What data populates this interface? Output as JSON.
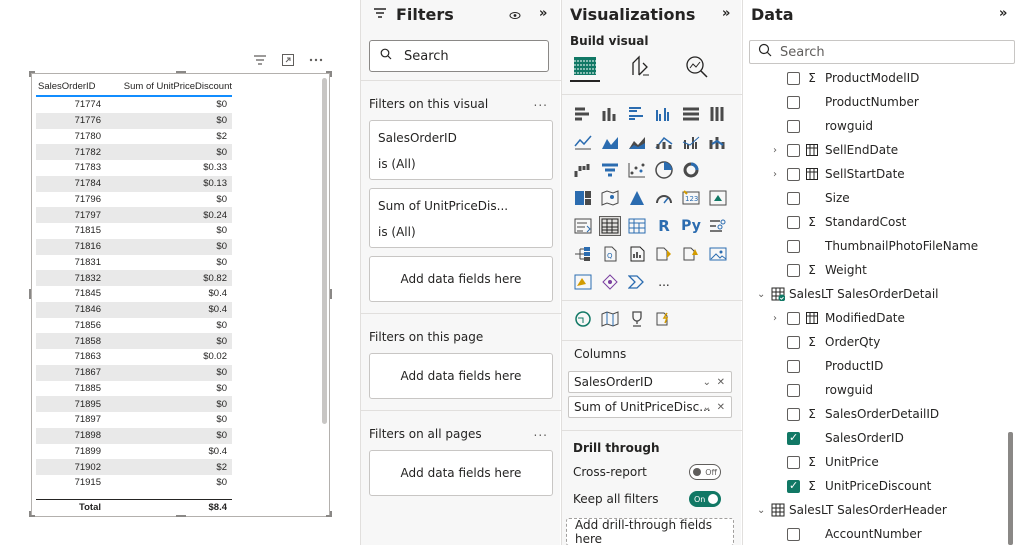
{
  "table_visual": {
    "columns": [
      "SalesOrderID",
      "Sum of UnitPriceDiscount"
    ],
    "rows": [
      [
        "71774",
        "$0"
      ],
      [
        "71776",
        "$0"
      ],
      [
        "71780",
        "$2"
      ],
      [
        "71782",
        "$0"
      ],
      [
        "71783",
        "$0.33"
      ],
      [
        "71784",
        "$0.13"
      ],
      [
        "71796",
        "$0"
      ],
      [
        "71797",
        "$0.24"
      ],
      [
        "71815",
        "$0"
      ],
      [
        "71816",
        "$0"
      ],
      [
        "71831",
        "$0"
      ],
      [
        "71832",
        "$0.82"
      ],
      [
        "71845",
        "$0.4"
      ],
      [
        "71846",
        "$0.4"
      ],
      [
        "71856",
        "$0"
      ],
      [
        "71858",
        "$0"
      ],
      [
        "71863",
        "$0.02"
      ],
      [
        "71867",
        "$0"
      ],
      [
        "71885",
        "$0"
      ],
      [
        "71895",
        "$0"
      ],
      [
        "71897",
        "$0"
      ],
      [
        "71898",
        "$0"
      ],
      [
        "71899",
        "$0.4"
      ],
      [
        "71902",
        "$2"
      ],
      [
        "71915",
        "$0"
      ]
    ],
    "total_label": "Total",
    "total_value": "$8.4",
    "header_icons": [
      "filter-icon",
      "focus-mode-icon",
      "more-options-icon"
    ]
  },
  "filters": {
    "title": "Filters",
    "search_placeholder": "Search",
    "on_visual_label": "Filters on this visual",
    "cards": [
      {
        "field": "SalesOrderID",
        "state": "is (All)"
      },
      {
        "field": "Sum of UnitPriceDis...",
        "state": "is (All)"
      }
    ],
    "add_fields": "Add data fields here",
    "on_page_label": "Filters on this page",
    "on_all_pages_label": "Filters on all pages",
    "more": "..."
  },
  "visualizations": {
    "title": "Visualizations",
    "build_visual": "Build visual",
    "more_visuals": "...",
    "columns_label": "Columns",
    "wells": [
      "SalesOrderID",
      "Sum of UnitPriceDisc..."
    ],
    "drill_through_label": "Drill through",
    "cross_report_label": "Cross-report",
    "cross_report_state": "Off",
    "keep_filters_label": "Keep all filters",
    "keep_filters_state": "On",
    "drill_add": "Add drill-through fields here"
  },
  "data_pane": {
    "title": "Data",
    "search_placeholder": "Search",
    "items": [
      {
        "kind": "field",
        "label": "ProductModelID",
        "sigma": true,
        "checked": false
      },
      {
        "kind": "field",
        "label": "ProductNumber",
        "sigma": false,
        "checked": false
      },
      {
        "kind": "field",
        "label": "rowguid",
        "sigma": false,
        "checked": false
      },
      {
        "kind": "field",
        "label": "SellEndDate",
        "calendar": true,
        "expandable": true,
        "checked": false
      },
      {
        "kind": "field",
        "label": "SellStartDate",
        "calendar": true,
        "expandable": true,
        "checked": false
      },
      {
        "kind": "field",
        "label": "Size",
        "sigma": false,
        "checked": false
      },
      {
        "kind": "field",
        "label": "StandardCost",
        "sigma": true,
        "checked": false
      },
      {
        "kind": "field",
        "label": "ThumbnailPhotoFileName",
        "sigma": false,
        "checked": false
      },
      {
        "kind": "field",
        "label": "Weight",
        "sigma": true,
        "checked": false
      },
      {
        "kind": "table",
        "label": "SalesLT SalesOrderDetail",
        "active": true
      },
      {
        "kind": "field",
        "label": "ModifiedDate",
        "calendar": true,
        "expandable": true,
        "checked": false
      },
      {
        "kind": "field",
        "label": "OrderQty",
        "sigma": true,
        "checked": false
      },
      {
        "kind": "field",
        "label": "ProductID",
        "sigma": false,
        "checked": false
      },
      {
        "kind": "field",
        "label": "rowguid",
        "sigma": false,
        "checked": false
      },
      {
        "kind": "field",
        "label": "SalesOrderDetailID",
        "sigma": true,
        "checked": false
      },
      {
        "kind": "field",
        "label": "SalesOrderID",
        "sigma": false,
        "checked": true
      },
      {
        "kind": "field",
        "label": "UnitPrice",
        "sigma": true,
        "checked": false
      },
      {
        "kind": "field",
        "label": "UnitPriceDiscount",
        "sigma": true,
        "checked": true
      },
      {
        "kind": "table",
        "label": "SalesLT SalesOrderHeader",
        "active": false
      },
      {
        "kind": "field",
        "label": "AccountNumber",
        "sigma": false,
        "checked": false
      }
    ]
  },
  "colors": {
    "accent_teal": "#117865",
    "header_underline": "#118dff",
    "pane_bg": "#f7f7f7"
  }
}
